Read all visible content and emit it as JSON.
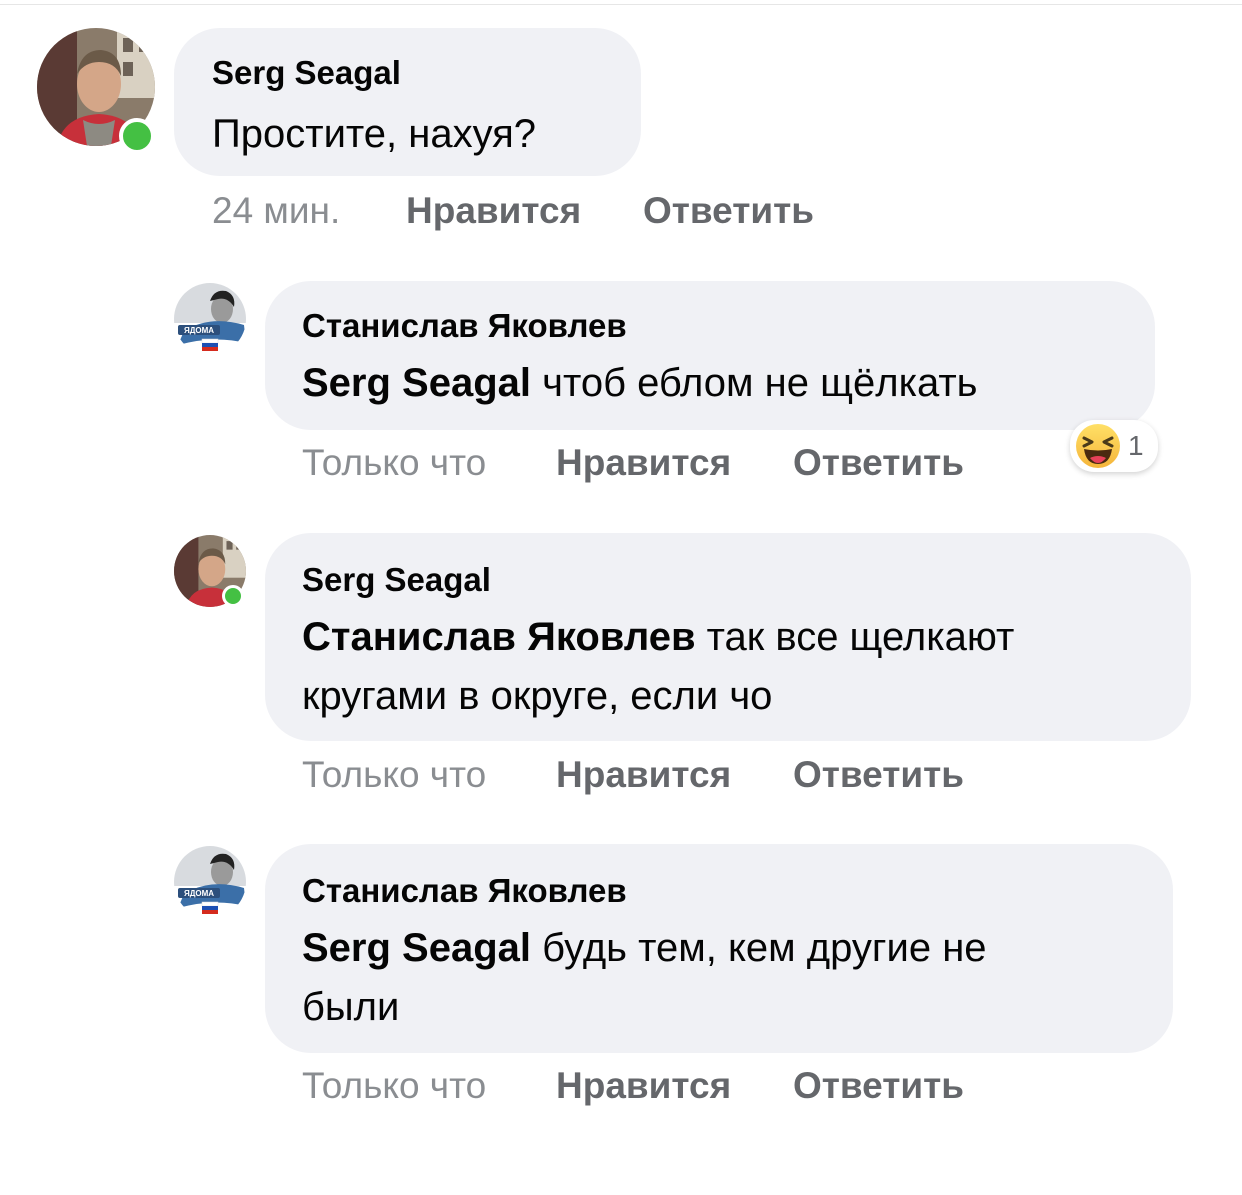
{
  "comments": [
    {
      "author": "Serg Seagal",
      "mention": "",
      "text": "Простите, нахуя?",
      "time": "24 мин.",
      "like": "Нравится",
      "reply": "Ответить",
      "online": true
    },
    {
      "author": "Станислав Яковлев",
      "mention": "Serg Seagal",
      "text": " чтоб еблом не щёлкать",
      "time": "Только что",
      "like": "Нравится",
      "reply": "Ответить",
      "reaction": {
        "icon": "laughing-emoji-icon",
        "count": "1"
      },
      "avatar_badge": "ЯДОМА"
    },
    {
      "author": "Serg Seagal",
      "mention": "Станислав Яковлев",
      "text_line1": " так все щелкают",
      "text_line2": "кругами в округе, если чо",
      "time": "Только что",
      "like": "Нравится",
      "reply": "Ответить",
      "online": true
    },
    {
      "author": "Станислав Яковлев",
      "mention": "Serg Seagal",
      "text_line1": " будь тем, кем другие не",
      "text_line2": "были",
      "time": "Только что",
      "like": "Нравится",
      "reply": "Ответить",
      "avatar_badge": "ЯДОМА"
    }
  ],
  "colors": {
    "bubble": "#f0f1f5",
    "online": "#44c043",
    "action": "#65676b",
    "time": "#8a8d91"
  }
}
